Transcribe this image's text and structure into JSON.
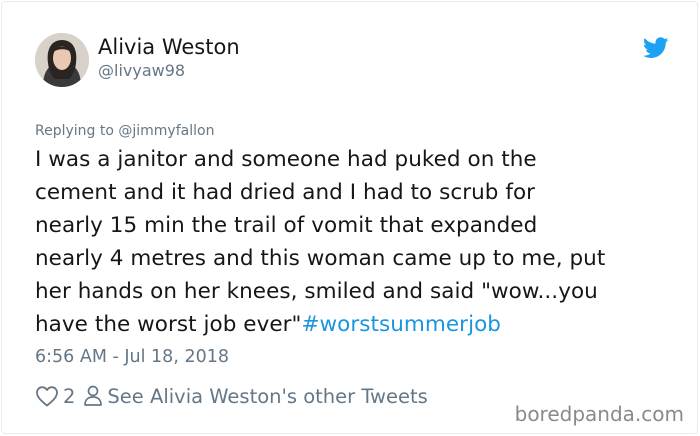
{
  "user": {
    "display_name": "Alivia Weston",
    "handle": "@livyaw98"
  },
  "tweet": {
    "replying_to": "Replying to @jimmyfallon",
    "text": "I was a janitor and someone had puked on the\ncement and it had dried and I had to scrub for\nnearly 15 min the trail of vomit that expanded\nnearly 4 metres and this woman came up to me, put\nher hands on her knees, smiled and said \"wow...you\nhave the worst job ever\"",
    "hashtag": "#worstsummerjob",
    "timestamp": "6:56 AM - Jul 18, 2018"
  },
  "actions": {
    "like_count": "2",
    "other_tweets_label": "See Alivia Weston's other Tweets"
  },
  "icons": {
    "brand": "twitter-bird-icon",
    "like": "heart-icon",
    "profile": "person-icon"
  },
  "colors": {
    "twitter_blue": "#1da1f2",
    "hashtag_blue": "#1b95e0",
    "secondary_text": "#657786"
  },
  "watermark": "boredpanda.com"
}
